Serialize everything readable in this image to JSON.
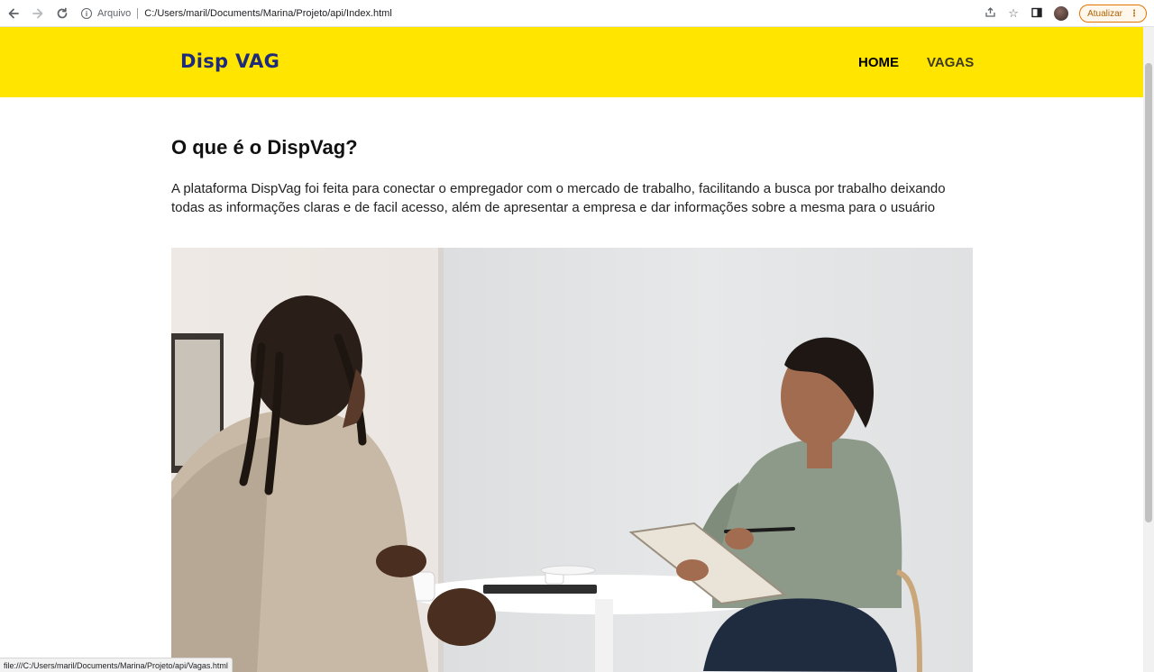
{
  "browser": {
    "back_icon": "arrow-left-icon",
    "forward_icon": "arrow-right-icon",
    "reload_icon": "reload-icon",
    "security_label": "Arquivo",
    "url": "C:/Users/maril/Documents/Marina/Projeto/api/Index.html",
    "update_label": "Atualizar"
  },
  "site": {
    "logo_text": "Disp VAG",
    "nav": [
      {
        "label": "HOME"
      },
      {
        "label": "VAGAS"
      }
    ],
    "brand_color": "#ffe500",
    "logo_color": "#1e2b7a"
  },
  "main": {
    "title": "O que é o DispVag?",
    "intro": "A plataforma DispVag foi feita para conectar o empregador com o mercado de trabalho, facilitando a busca por trabalho deixando todas as informações claras e de facil acesso, além de apresentar a empresa e dar informações sobre a mesma para o usuário"
  },
  "status_bar": {
    "hover_url": "file:///C:/Users/maril/Documents/Marina/Projeto/api/Vagas.html"
  }
}
